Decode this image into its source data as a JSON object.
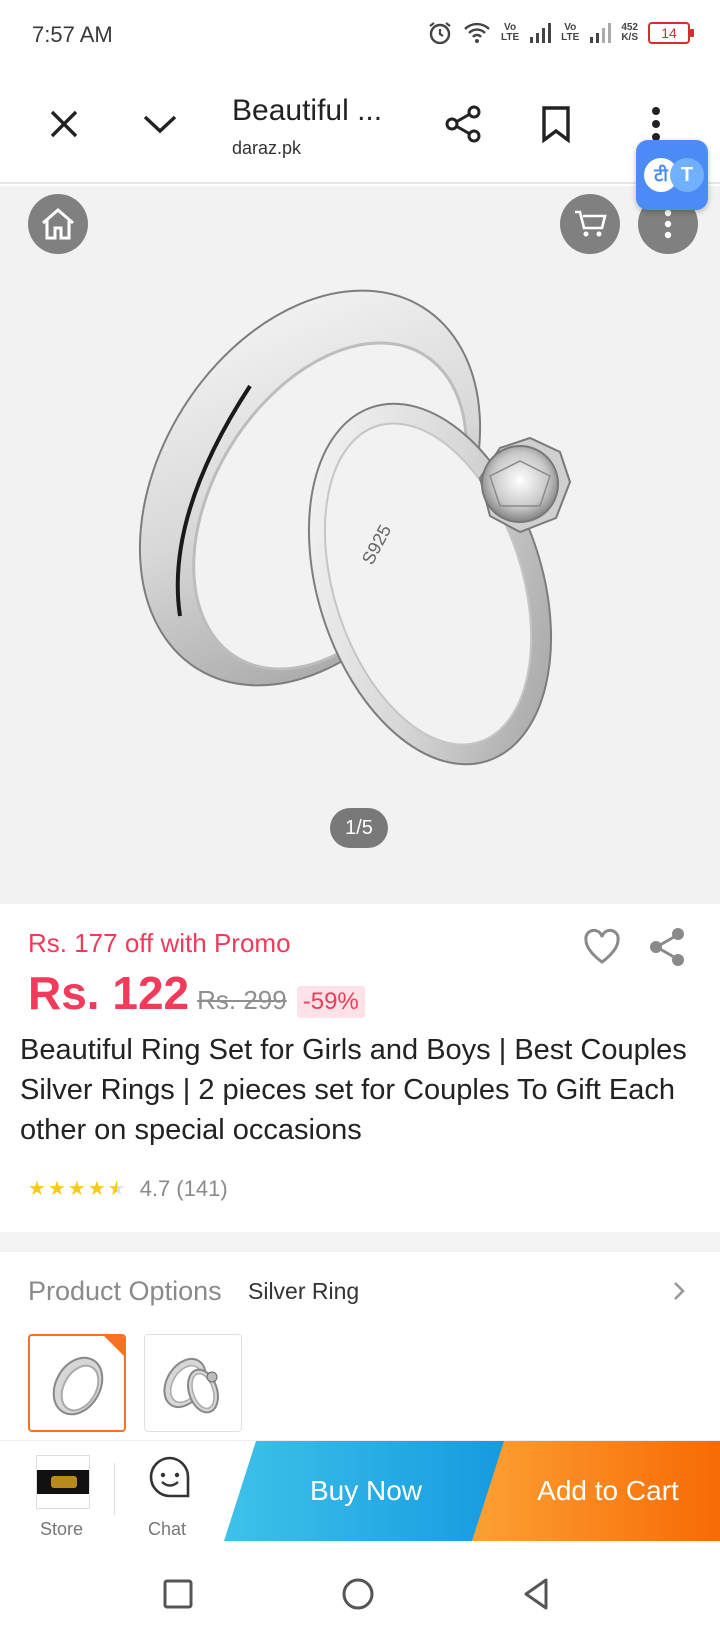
{
  "status_bar": {
    "time": "7:57 AM",
    "network_1": "Vo\nLTE",
    "network_2": "Vo\nLTE",
    "speed": "452\nK/S",
    "battery": "14"
  },
  "toolbar": {
    "page_title": "Beautiful ...",
    "domain": "daraz.pk",
    "translate_badge_text_1": "टी",
    "translate_badge_text_2": "T"
  },
  "gallery": {
    "page_indicator": "1/5",
    "ring_inscription": "S925"
  },
  "product": {
    "promo_text": "Rs. 177 off with Promo",
    "price": "Rs. 122",
    "original_price": "Rs. 299",
    "discount": "-59%",
    "title": "Beautiful Ring Set for Girls and Boys | Best Couples Silver Rings | 2 pieces set for Couples To Gift Each other on special occasions",
    "rating": "4.7",
    "rating_count": "(141)",
    "stars_filled": 4.5
  },
  "options": {
    "label": "Product Options",
    "selected_value": "Silver Ring"
  },
  "action_bar": {
    "store_label": "Store",
    "chat_label": "Chat",
    "buy_now_label": "Buy Now",
    "add_to_cart_label": "Add to Cart"
  },
  "colors": {
    "price_red": "#f23a5a",
    "accent_orange": "#f57224",
    "buy_blue": "#169ae0",
    "star_yellow": "#faca15"
  }
}
